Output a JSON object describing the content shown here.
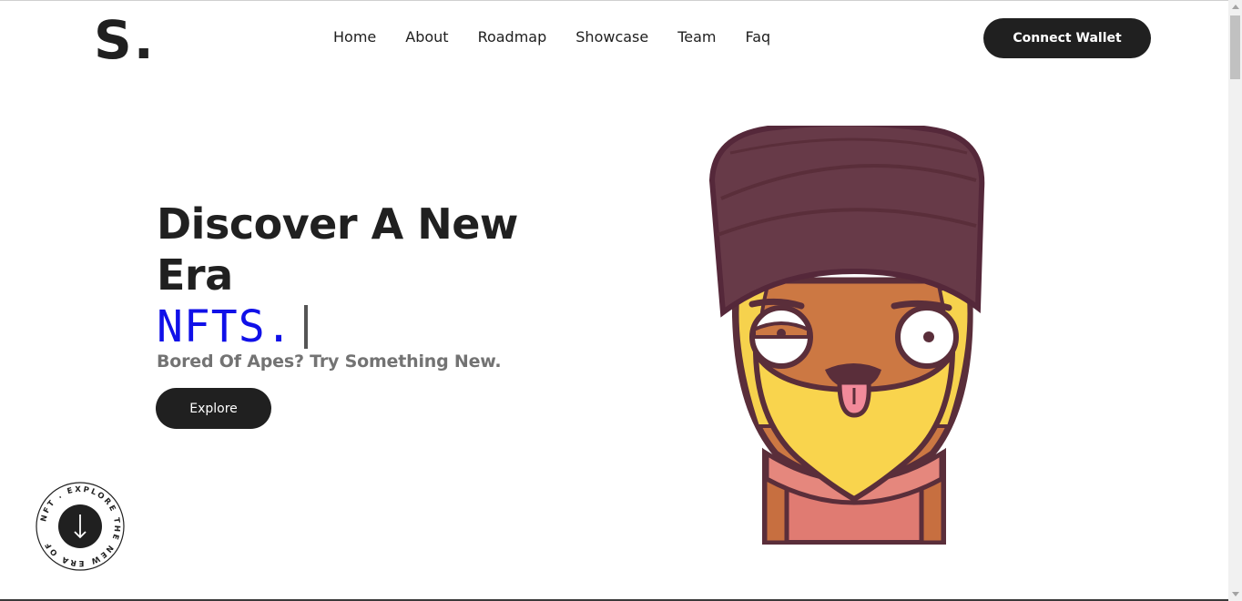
{
  "brand": {
    "logo": "S."
  },
  "nav": {
    "items": [
      "Home",
      "About",
      "Roadmap",
      "Showcase",
      "Team",
      "Faq"
    ],
    "connect_label": "Connect Wallet"
  },
  "hero": {
    "title": "Discover A New Era",
    "typed": "NFTS.",
    "subtitle": "Bored Of Apes? Try Something New.",
    "explore_label": "Explore"
  },
  "badge": {
    "ring_text": "NFT . EXPLORE THE NEW ERA OF",
    "icon": "arrow-down-icon"
  },
  "colors": {
    "dark": "#202020",
    "accent_typed": "#1010e8",
    "subtitle": "#737373"
  }
}
